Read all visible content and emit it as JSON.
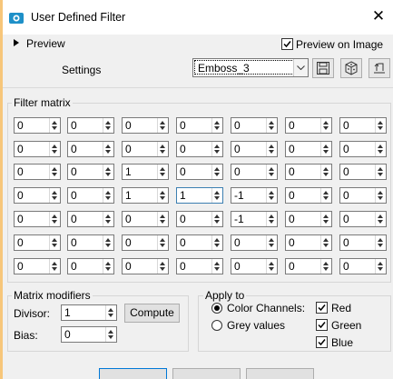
{
  "window": {
    "title": "User Defined Filter",
    "close_glyph": "✕"
  },
  "preview": {
    "label": "Preview",
    "on_image_label": "Preview on Image",
    "on_image_checked": true
  },
  "settings": {
    "label": "Settings",
    "preset": "Emboss_3"
  },
  "toolbar": {
    "icons": [
      "save-icon",
      "randomize-icon",
      "reset-icon"
    ]
  },
  "filter_matrix": {
    "label": "Filter matrix",
    "rows": [
      [
        "0",
        "0",
        "0",
        "0",
        "0",
        "0",
        "0"
      ],
      [
        "0",
        "0",
        "0",
        "0",
        "0",
        "0",
        "0"
      ],
      [
        "0",
        "0",
        "1",
        "0",
        "0",
        "0",
        "0"
      ],
      [
        "0",
        "0",
        "1",
        "1",
        "-1",
        "0",
        "0"
      ],
      [
        "0",
        "0",
        "0",
        "0",
        "-1",
        "0",
        "0"
      ],
      [
        "0",
        "0",
        "0",
        "0",
        "0",
        "0",
        "0"
      ],
      [
        "0",
        "0",
        "0",
        "0",
        "0",
        "0",
        "0"
      ]
    ]
  },
  "matrix_modifiers": {
    "label": "Matrix modifiers",
    "divisor_label": "Divisor:",
    "divisor": "1",
    "bias_label": "Bias:",
    "bias": "0",
    "compute_label": "Compute"
  },
  "apply_to": {
    "label": "Apply to",
    "color_channels_label": "Color Channels:",
    "color_channels_selected": true,
    "grey_values_label": "Grey values",
    "red_label": "Red",
    "green_label": "Green",
    "blue_label": "Blue"
  },
  "colors": {
    "background": "#f7c67a",
    "dialog": "#f0f0f0",
    "title_icon": "#1e90c8"
  }
}
